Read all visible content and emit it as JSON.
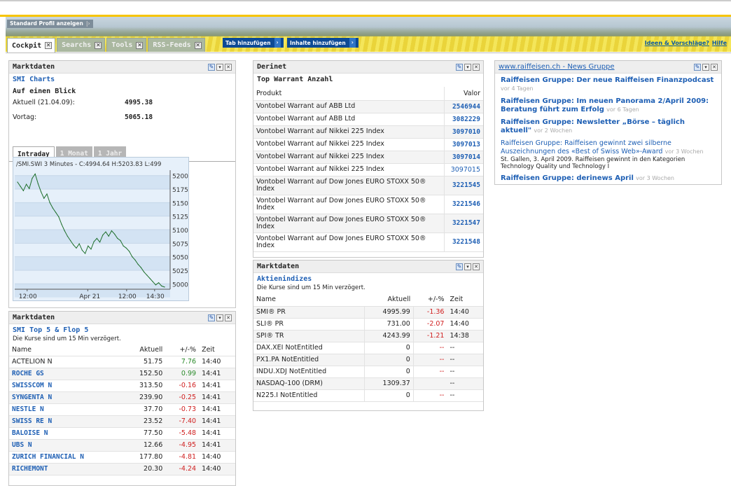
{
  "header": {
    "std_profile": "Standard Profil anzeigen",
    "tabs": [
      {
        "label": "Cockpit",
        "active": true
      },
      {
        "label": "Searchs",
        "active": false
      },
      {
        "label": "Tools",
        "active": false
      },
      {
        "label": "RSS-Feeds",
        "active": false
      }
    ],
    "add_tab": "Tab hinzufügen",
    "add_content": "Inhalte hinzufügen",
    "ideas": "Ideen & Vorschläge?",
    "help": "Hilfe"
  },
  "smi_panel": {
    "title": "Marktdaten",
    "subtitle": "SMI Charts",
    "glance": "Auf einen Blick",
    "current_label": "Aktuell (21.04.09):",
    "current_value": "4995.38",
    "prev_label": "Vortag:",
    "prev_value": "5065.18",
    "chart_tabs": [
      "Intraday",
      "1 Monat",
      "1 Jahr"
    ]
  },
  "chart_data": {
    "type": "line",
    "title": "/SMI.SWI 3 Minutes -   C:4994.64 H:5203.83 L:499",
    "ylim": [
      4990,
      5210
    ],
    "yticks": [
      "5200",
      "5175",
      "5150",
      "5125",
      "5100",
      "5075",
      "5050",
      "5025",
      "5000"
    ],
    "xticks": [
      "12:00",
      "Apr 21",
      "12:00",
      "14:30"
    ],
    "series": [
      {
        "values": [
          5188,
          5180,
          5172,
          5184,
          5176,
          5195,
          5203,
          5185,
          5170,
          5158,
          5166,
          5150,
          5140,
          5132,
          5124,
          5110,
          5098,
          5088,
          5080,
          5072,
          5066,
          5074,
          5062,
          5056,
          5070,
          5064,
          5078,
          5084,
          5077,
          5090,
          5096,
          5088,
          5098,
          5092,
          5084,
          5080,
          5070,
          5066,
          5060,
          5050,
          5044,
          5036,
          5030,
          5022,
          5016,
          5010,
          5004,
          4998,
          5002,
          4996,
          4994
        ]
      }
    ]
  },
  "top5": {
    "title": "Marktdaten",
    "subtitle": "SMI Top 5 & Flop 5",
    "note": "Die Kurse sind um 15 Min verzögert.",
    "columns": [
      "Name",
      "Aktuell",
      "+/-%",
      "Zeit"
    ],
    "rows": [
      {
        "name": "ACTELION N",
        "link": false,
        "price": "51.75",
        "chg": "7.76",
        "dir": "pos",
        "time": "14:40"
      },
      {
        "name": "ROCHE GS",
        "link": true,
        "price": "152.50",
        "chg": "0.99",
        "dir": "pos",
        "time": "14:41"
      },
      {
        "name": "SWISSCOM N",
        "link": true,
        "price": "313.50",
        "chg": "-0.16",
        "dir": "neg",
        "time": "14:41"
      },
      {
        "name": "SYNGENTA N",
        "link": true,
        "price": "239.90",
        "chg": "-0.25",
        "dir": "neg",
        "time": "14:41"
      },
      {
        "name": "NESTLE N",
        "link": true,
        "price": "37.70",
        "chg": "-0.73",
        "dir": "neg",
        "time": "14:41"
      },
      {
        "name": "SWISS RE N",
        "link": true,
        "price": "23.52",
        "chg": "-7.40",
        "dir": "neg",
        "time": "14:41"
      },
      {
        "name": "BALOISE N",
        "link": true,
        "price": "77.50",
        "chg": "-5.48",
        "dir": "neg",
        "time": "14:41"
      },
      {
        "name": "UBS N",
        "link": true,
        "price": "12.66",
        "chg": "-4.95",
        "dir": "neg",
        "time": "14:41"
      },
      {
        "name": "ZURICH FINANCIAL N",
        "link": true,
        "price": "177.80",
        "chg": "-4.81",
        "dir": "neg",
        "time": "14:40"
      },
      {
        "name": "RICHEMONT",
        "link": true,
        "price": "20.30",
        "chg": "-4.24",
        "dir": "neg",
        "time": "14:40"
      }
    ]
  },
  "derinet": {
    "title": "Derinet",
    "subtitle": "Top Warrant Anzahl",
    "columns": [
      "Produkt",
      "Valor"
    ],
    "rows": [
      {
        "product": "Vontobel Warrant auf ABB Ltd",
        "valor": "2546944",
        "bold": true
      },
      {
        "product": "Vontobel Warrant auf ABB Ltd",
        "valor": "3082229",
        "bold": true
      },
      {
        "product": "Vontobel Warrant auf Nikkei 225 Index",
        "valor": "3097010",
        "bold": true
      },
      {
        "product": "Vontobel Warrant auf Nikkei 225 Index",
        "valor": "3097013",
        "bold": true
      },
      {
        "product": "Vontobel Warrant auf Nikkei 225 Index",
        "valor": "3097014",
        "bold": true
      },
      {
        "product": "Vontobel Warrant auf Nikkei 225 Index",
        "valor": "3097015",
        "bold": false
      },
      {
        "product": "Vontobel Warrant auf Dow Jones EURO STOXX 50® Index",
        "valor": "3221545",
        "bold": true
      },
      {
        "product": "Vontobel Warrant auf Dow Jones EURO STOXX 50® Index",
        "valor": "3221546",
        "bold": true
      },
      {
        "product": "Vontobel Warrant auf Dow Jones EURO STOXX 50® Index",
        "valor": "3221547",
        "bold": true
      },
      {
        "product": "Vontobel Warrant auf Dow Jones EURO STOXX 50® Index",
        "valor": "3221548",
        "bold": true
      }
    ]
  },
  "indices": {
    "title": "Marktdaten",
    "subtitle": "Aktienindizes",
    "note": "Die Kurse sind um 15 Min verzögert.",
    "columns": [
      "Name",
      "Aktuell",
      "+/-%",
      "Zeit"
    ],
    "rows": [
      {
        "name": "SMI® PR",
        "price": "4995.99",
        "chg": "-1.36",
        "time": "14:40"
      },
      {
        "name": "SLI® PR",
        "price": "731.00",
        "chg": "-2.07",
        "time": "14:40"
      },
      {
        "name": "SPI® TR",
        "price": "4243.99",
        "chg": "-1.21",
        "time": "14:38"
      },
      {
        "name": "DAX.XEI NotEntitled",
        "price": "0",
        "chg": "--",
        "time": "--"
      },
      {
        "name": "PX1.PA NotEntitled",
        "price": "0",
        "chg": "--",
        "time": "--"
      },
      {
        "name": "INDU.XDJ NotEntitled",
        "price": "0",
        "chg": "--",
        "time": "--"
      },
      {
        "name": "NASDAQ-100 (DRM)",
        "price": "1309.37",
        "chg": "",
        "time": "--"
      },
      {
        "name": "N225.I NotEntitled",
        "price": "0",
        "chg": "--",
        "time": "--"
      }
    ]
  },
  "news": {
    "title": "www.raiffeisen.ch - News Gruppe",
    "items": [
      {
        "headline": "Raiffeisen Gruppe: Der neue Raiffeisen Finanzpodcast",
        "age": "vor 4 Tagen",
        "bold": true,
        "body": ""
      },
      {
        "headline": "Raiffeisen Gruppe: Im neuen Panorama 2/April 2009: Beratung führt zum Erfolg",
        "age": "vor 6 Tagen",
        "bold": true,
        "body": ""
      },
      {
        "headline": "Raiffeisen Gruppe: Newsletter „Börse – täglich aktuell\"",
        "age": "vor 2 Wochen",
        "bold": true,
        "body": ""
      },
      {
        "headline": "Raiffeisen Gruppe: Raiffeisen gewinnt zwei silberne Auszeichnungen des «Best of Swiss Web»-Award",
        "age": "vor 3 Wochen",
        "bold": false,
        "body": "St. Gallen, 3. April 2009. Raiffeisen gewinnt in den Kategorien Technology Quality und Technology I"
      },
      {
        "headline": "Raiffeisen Gruppe: derinews April",
        "age": "vor 3 Wochen",
        "bold": true,
        "body": ""
      }
    ]
  }
}
